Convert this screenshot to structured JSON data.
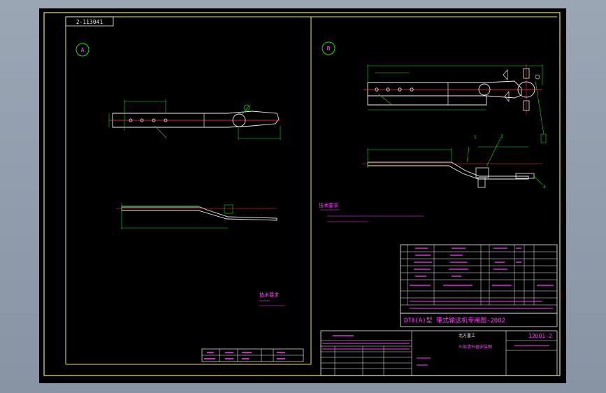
{
  "drawing": {
    "stamp_code": "2-113041",
    "view_a_label": "A",
    "view_b_label": "B",
    "view_a_tech_note": "技术要求",
    "view_b_tech_note": "技术要求",
    "main_title": "DTⅡ(A)型  带式输送机专用图-2002",
    "doc_code": "12001-2",
    "company": "北方重工",
    "part_name": "头部清扫器安装图",
    "callouts": [
      "1",
      "2",
      "3"
    ]
  },
  "colors": {
    "background": "#000000",
    "frame": "#e8e84a",
    "dimension": "#10e010",
    "geometry": "#f0f0f0",
    "centerline": "#ff3b3b",
    "text": "#ff3cff",
    "yellow_circle": "#f0f040"
  }
}
